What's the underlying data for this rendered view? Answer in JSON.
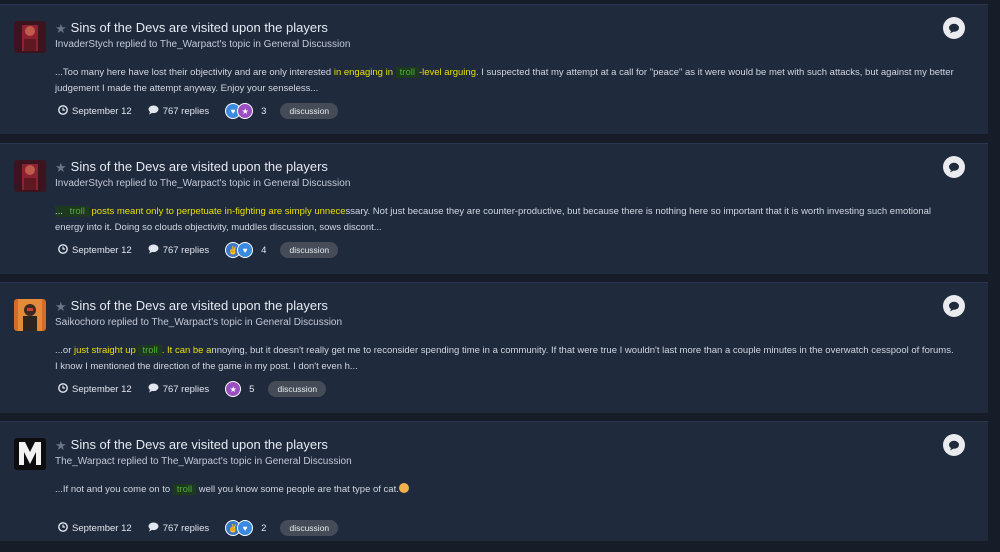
{
  "posts": [
    {
      "title": "Sins of the Devs are visited upon the players",
      "meta": "InvaderStych replied to The_Warpact's topic in General Discussion",
      "snippet": [
        {
          "text": "...Too many here have lost their objectivity and are only interested ",
          "style": ""
        },
        {
          "text": "in engaging in ",
          "style": "y"
        },
        {
          "text": "troll",
          "style": "g"
        },
        {
          "text": "-level arguing",
          "style": "y"
        },
        {
          "text": ". I suspected that my attempt at a call for \"peace\" as it were would be met with such attacks, but against my better judgement I made the attempt anyway. Enjoy your senseless...",
          "style": ""
        }
      ],
      "date": "September 12",
      "replies": "767 replies",
      "reaction_icons": [
        "heart",
        "trophy"
      ],
      "reaction_count": "3",
      "tag": "discussion",
      "avatar": "red"
    },
    {
      "title": "Sins of the Devs are visited upon the players",
      "meta": "InvaderStych replied to The_Warpact's topic in General Discussion",
      "snippet": [
        {
          "text": "... ",
          "style": "bg"
        },
        {
          "text": "troll",
          "style": "g"
        },
        {
          "text": " posts meant only to perpetuate in-fighting are simply unnece",
          "style": "y"
        },
        {
          "text": "ssary. Not just because they are counter-productive, but because there is nothing here so important that it is worth investing such emotional energy into it. Doing so clouds objectivity, muddles discussion, sows discont...",
          "style": ""
        }
      ],
      "date": "September 12",
      "replies": "767 replies",
      "reaction_icons": [
        "like",
        "heart"
      ],
      "reaction_count": "4",
      "tag": "discussion",
      "avatar": "red"
    },
    {
      "title": "Sins of the Devs are visited upon the players",
      "meta": "Saikochoro replied to The_Warpact's topic in General Discussion",
      "snippet": [
        {
          "text": "...or ",
          "style": ""
        },
        {
          "text": "just straight up ",
          "style": "y"
        },
        {
          "text": "troll",
          "style": "g"
        },
        {
          "text": ". It can be a",
          "style": "y"
        },
        {
          "text": "nnoying, but it doesn't really get me to reconsider spending time in a community. If that were true I wouldn't last more than a couple minutes in the overwatch cesspool of forums. I know I mentioned the direction of the game in my post. I don't even h...",
          "style": ""
        }
      ],
      "date": "September 12",
      "replies": "767 replies",
      "reaction_icons": [
        "trophy"
      ],
      "reaction_count": "5",
      "tag": "discussion",
      "avatar": "warrior"
    },
    {
      "title": "Sins of the Devs are visited upon the players",
      "meta": "The_Warpact replied to The_Warpact's topic in General Discussion",
      "snippet": [
        {
          "text": "...If not and you come on to ",
          "style": ""
        },
        {
          "text": "troll",
          "style": "g"
        },
        {
          "text": " well you know some people are that type of cat.",
          "style": ""
        },
        {
          "text": "",
          "style": "emoji"
        }
      ],
      "date": "September 12",
      "replies": "767 replies",
      "reaction_icons": [
        "like",
        "heart"
      ],
      "reaction_count": "2",
      "tag": "discussion",
      "avatar": "m-logo"
    }
  ],
  "colors": {
    "background": "#161d28",
    "card": "#1f2a3d",
    "highlight_yellow": "#e8e000",
    "highlight_green": "#4fae3a",
    "tag_bg": "#454c57"
  },
  "icons": {
    "star": "star-icon",
    "clock": "clock-icon",
    "replies": "comment-icon",
    "bubble": "speech-bubble-icon"
  }
}
